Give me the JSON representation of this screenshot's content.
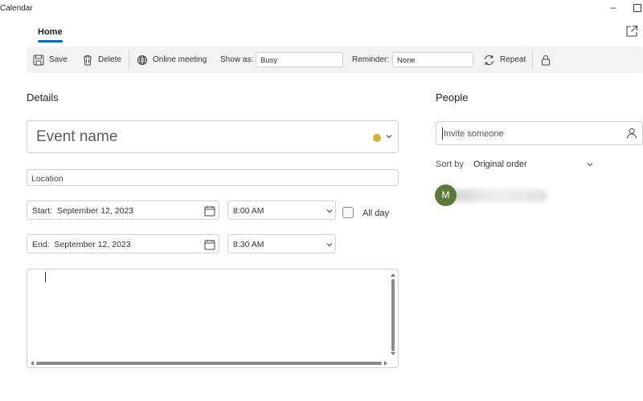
{
  "window": {
    "title": "Calendar",
    "minimize_glyph": "–"
  },
  "tabs": {
    "home": "Home"
  },
  "ribbon": {
    "save": "Save",
    "delete": "Delete",
    "online_meeting": "Online meeting",
    "show_as_label": "Show as:",
    "show_as_value": "Busy",
    "reminder_label": "Reminder:",
    "reminder_value": "None",
    "repeat": "Repeat"
  },
  "details": {
    "title": "Details",
    "event_name_placeholder": "Event name",
    "event_color": "#c9b72f",
    "location_placeholder": "Location",
    "start_label": "Start:  September 12, 2023",
    "start_time": "8:00 AM",
    "end_label": "End:  September 12, 2023",
    "end_time": "8:30 AM",
    "all_day_label": "All day"
  },
  "people": {
    "title": "People",
    "invite_placeholder": "Invite someone",
    "sort_by_label": "Sort by",
    "sort_by_value": "Original order",
    "attendee_initial": "M",
    "attendee_color": "#5b7a3a"
  },
  "colors": {
    "accent": "#0f6cbd",
    "ribbon_bg": "#f3f3f3"
  }
}
